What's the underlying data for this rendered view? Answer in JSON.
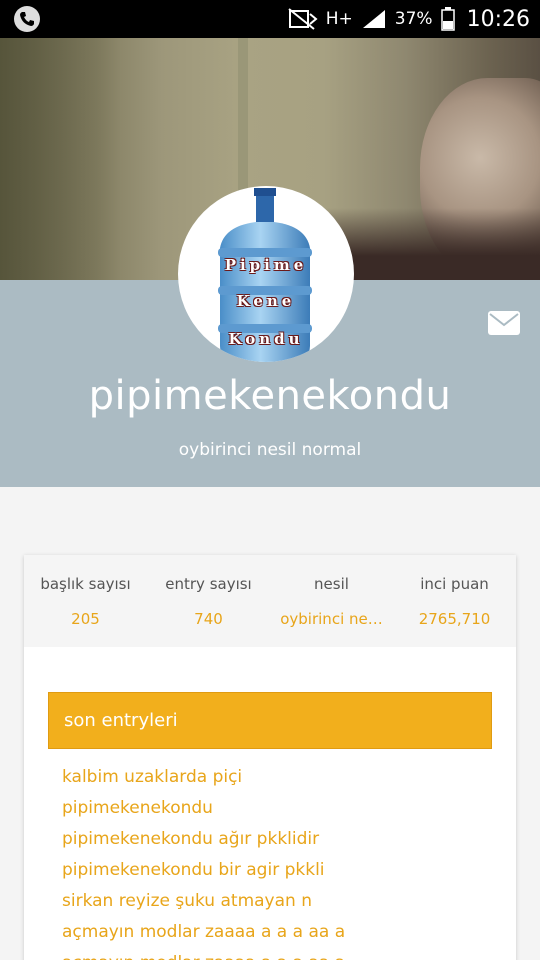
{
  "status_bar": {
    "battery": "37%",
    "clock": "10:26",
    "network": "H+",
    "icons": [
      "phone-icon",
      "mute-icon",
      "signal-icon",
      "battery-icon"
    ]
  },
  "profile": {
    "avatar_lines": [
      "Pipime",
      "Kene",
      "Kondu"
    ],
    "username": "pipimekenekondu",
    "generation": "oybirinci nesil normal"
  },
  "stats": [
    {
      "label": "başlık sayısı",
      "value": "205"
    },
    {
      "label": "entry sayısı",
      "value": "740"
    },
    {
      "label": "nesil",
      "value": "oybirinci ne…"
    },
    {
      "label": "inci puan",
      "value": "2765,710"
    }
  ],
  "recent_entries": {
    "title": "son entryleri",
    "items": [
      "kalbim uzaklarda piçi",
      "pipimekenekondu",
      "pipimekenekondu ağır pkklidir",
      "pipimekenekondu bir agir pkkli",
      "sirkan reyize şuku atmayan n",
      "açmayın modlar zaaaa a a a aa a",
      "açmayın modlar zaaaa a a a aa a"
    ]
  },
  "colors": {
    "accent": "#f2af1c",
    "band": "#abbbc3",
    "link": "#e8a51a"
  }
}
